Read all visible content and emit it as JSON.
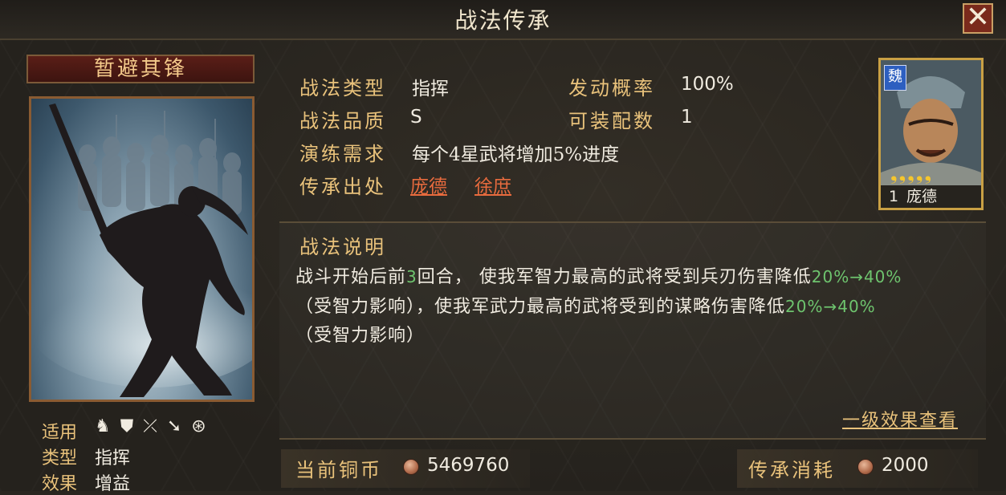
{
  "window": {
    "title": "战法传承",
    "close_label": "✕"
  },
  "skill": {
    "name": "暂避其锋",
    "meta": {
      "applicable_label": "适用",
      "applicable_icons": [
        "cavalry-icon",
        "shield-icon",
        "bow-icon",
        "spear-icon",
        "wheel-icon"
      ],
      "type_label": "类型",
      "type_value": "指挥",
      "effect_label": "效果",
      "effect_value": "增益"
    }
  },
  "info": {
    "type_label": "战法类型",
    "type_value": "指挥",
    "quality_label": "战法品质",
    "quality_value": "S",
    "requirement_label": "演练需求",
    "requirement_value": "每个4星武将增加5%进度",
    "source_label": "传承出处",
    "source_links": [
      "庞德",
      "徐庶"
    ],
    "trigger_label": "发动概率",
    "trigger_value": "100%",
    "equip_label": "可装配数",
    "equip_value": "1"
  },
  "general": {
    "faction": "魏",
    "stars": "❟❟❟❟❟",
    "level": "1",
    "name": "庞德"
  },
  "description": {
    "title": "战法说明",
    "line1_a": "战斗开始后前",
    "line1_num": "3",
    "line1_b": "回合， 使我军智力最高的武将受到兵刃伤害降低",
    "line1_hl": "20%→40%",
    "line2_a": "（受智力影响），使我军武力最高的武将受到的谋略伤害降低",
    "line2_hl": "20%→40%",
    "line3": "（受智力影响）",
    "view_link": "一级效果查看"
  },
  "footer": {
    "current_label": "当前铜币",
    "current_value": "5469760",
    "cost_label": "传承消耗",
    "cost_value": "2000"
  },
  "colors": {
    "accent": "#e9c27b",
    "link": "#e86b3e",
    "highlight": "#6ec46e",
    "frame": "#8a5b32"
  }
}
